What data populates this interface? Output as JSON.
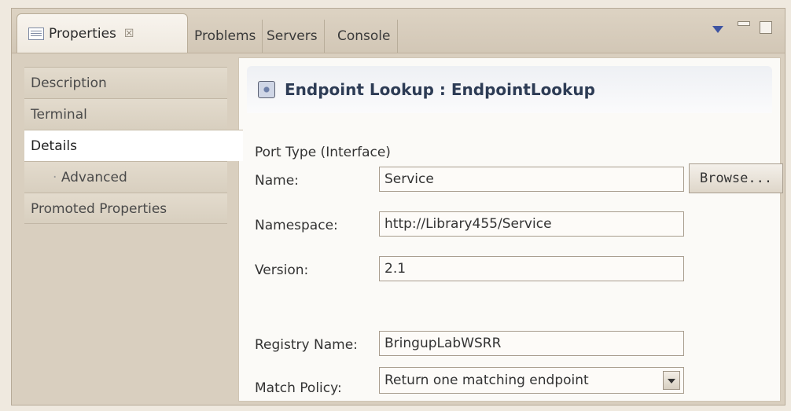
{
  "tabs": {
    "active": "Properties",
    "close_glyph": "☒",
    "others": [
      "Problems",
      "Servers",
      "Console"
    ]
  },
  "left_nav": {
    "items": [
      {
        "label": "Description"
      },
      {
        "label": "Terminal"
      },
      {
        "label": "Details",
        "selected": true
      },
      {
        "label": "Advanced",
        "sub": true
      },
      {
        "label": "Promoted Properties"
      }
    ]
  },
  "panel": {
    "title": "Endpoint Lookup : EndpointLookup",
    "section": "Port Type (Interface)",
    "name_label": "Name:",
    "name_value": "Service",
    "browse_label": "Browse...",
    "namespace_label": "Namespace:",
    "namespace_value": "http://Library455/Service",
    "version_label": "Version:",
    "version_value": "2.1",
    "registry_label": "Registry Name:",
    "registry_value": "BringupLabWSRR",
    "match_label": "Match Policy:",
    "match_value": "Return one matching endpoint"
  },
  "icons": {
    "properties": "properties-view-icon",
    "header": "endpoint-lookup-icon",
    "view_menu": "view-menu-icon",
    "minimize": "minimize-icon",
    "maximize": "maximize-icon"
  }
}
